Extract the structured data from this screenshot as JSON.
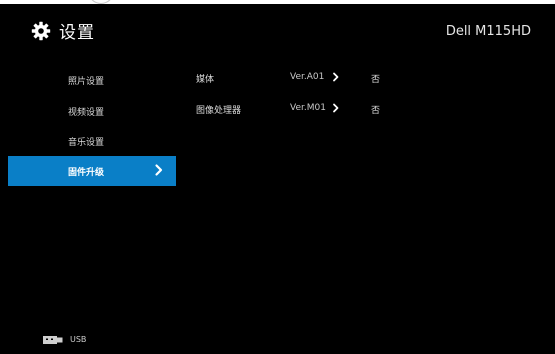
{
  "header": {
    "title": "设置",
    "model": "Dell M115HD"
  },
  "sidebar": {
    "items": [
      {
        "label": "照片设置"
      },
      {
        "label": "视频设置"
      },
      {
        "label": "音乐设置"
      },
      {
        "label": "固件升级",
        "active": true
      }
    ]
  },
  "firmware": {
    "rows": [
      {
        "name": "媒体",
        "version": "Ver.A01",
        "status": "否"
      },
      {
        "name": "图像处理器",
        "version": "Ver.M01",
        "status": "否"
      }
    ]
  },
  "footer": {
    "source": "USB"
  },
  "colors": {
    "background": "#000000",
    "accent": "#0a7fc7",
    "text": "#dcdcdc"
  },
  "icons": {
    "settings": "gear-icon",
    "chevron": "chevron-right-icon",
    "source": "usb-icon"
  }
}
